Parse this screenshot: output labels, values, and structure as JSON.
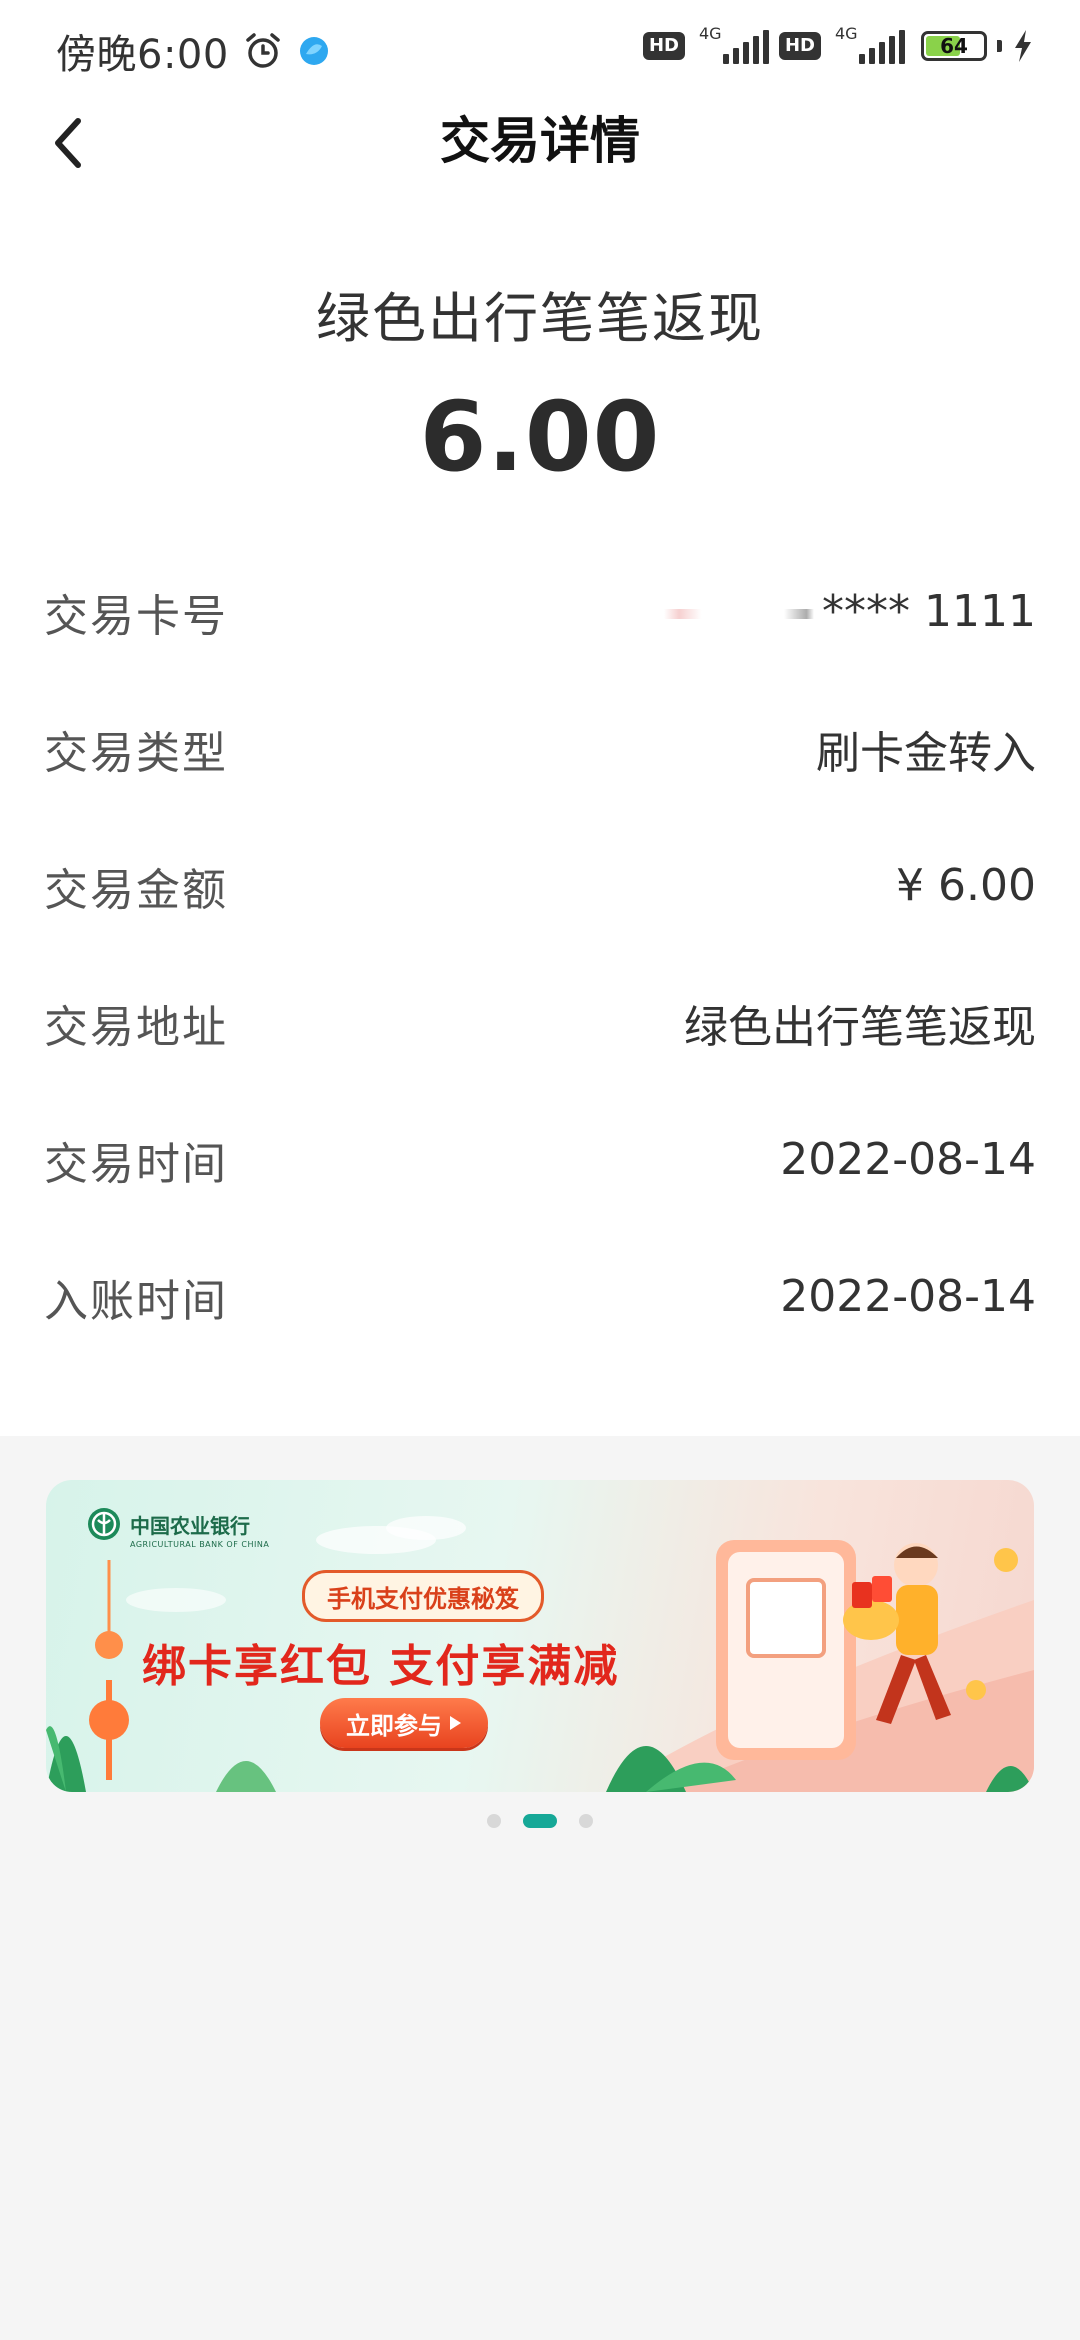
{
  "status_bar": {
    "time": "傍晚6:00",
    "hd1": "HD",
    "net1": "4G",
    "hd2": "HD",
    "net2": "4G",
    "battery": "64",
    "battery_fraction": 0.64
  },
  "header": {
    "title": "交易详情",
    "back_icon": "chevron-left-icon"
  },
  "summary": {
    "merchant": "绿色出行笔笔返现",
    "amount": "6.00"
  },
  "details": [
    {
      "label": "交易卡号",
      "value": "**** 1111"
    },
    {
      "label": "交易类型",
      "value": "刷卡金转入"
    },
    {
      "label": "交易金额",
      "value": "¥ 6.00"
    },
    {
      "label": "交易地址",
      "value": "绿色出行笔笔返现"
    },
    {
      "label": "交易时间",
      "value": "2022-08-14"
    },
    {
      "label": "入账时间",
      "value": "2022-08-14"
    }
  ],
  "banner": {
    "bank_name": "中国农业银行",
    "bank_name_en": "AGRICULTURAL BANK OF CHINA",
    "pill": "手机支付优惠秘笈",
    "headline": "绑卡享红包 支付享满减",
    "cta": "立即参与",
    "active_slide": 2,
    "slide_count": 3
  },
  "colors": {
    "accent": "#16a897",
    "promo_red": "#e2271c",
    "bank_green": "#1d6b4a"
  }
}
